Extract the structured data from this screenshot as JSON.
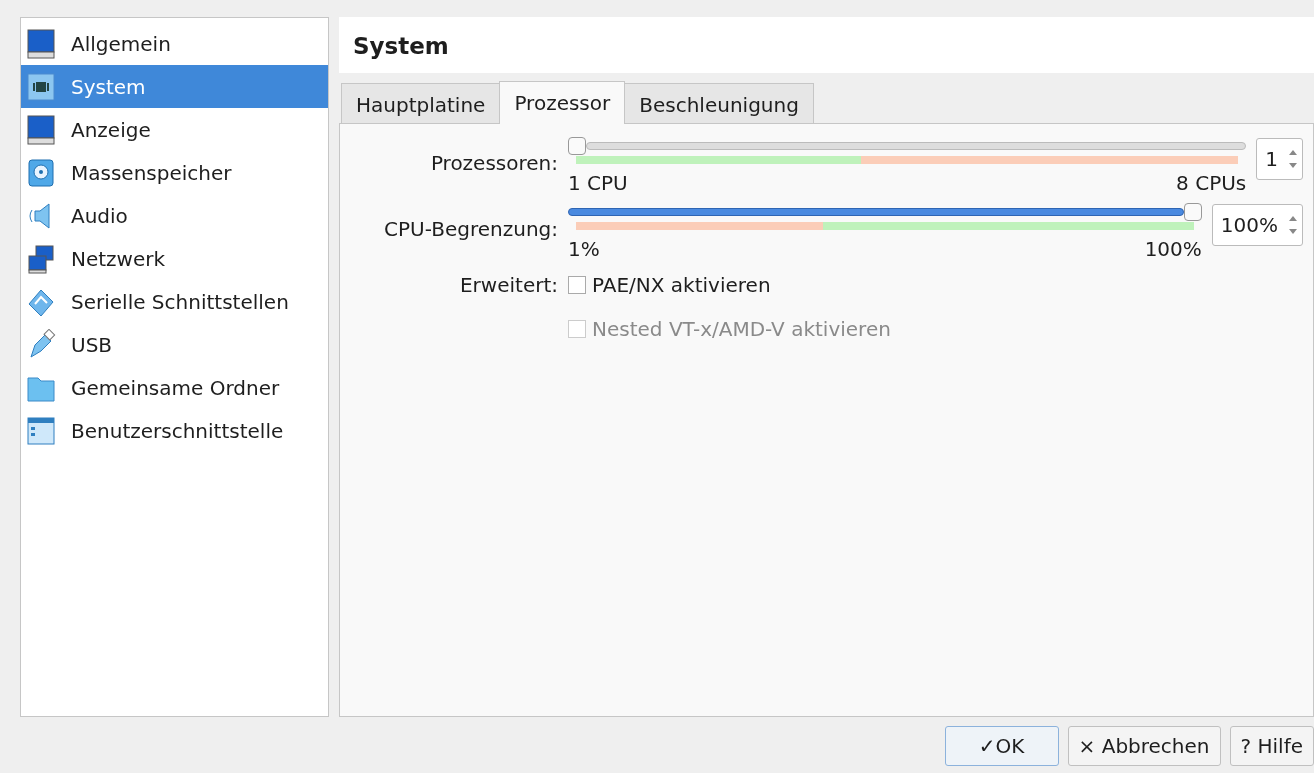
{
  "sidebar": {
    "items": [
      {
        "label": "Allgemein",
        "selected": false
      },
      {
        "label": "System",
        "selected": true
      },
      {
        "label": "Anzeige",
        "selected": false
      },
      {
        "label": "Massenspeicher",
        "selected": false
      },
      {
        "label": "Audio",
        "selected": false
      },
      {
        "label": "Netzwerk",
        "selected": false
      },
      {
        "label": "Serielle Schnittstellen",
        "selected": false
      },
      {
        "label": "USB",
        "selected": false
      },
      {
        "label": "Gemeinsame Ordner",
        "selected": false
      },
      {
        "label": "Benutzerschnittstelle",
        "selected": false
      }
    ]
  },
  "page_title": "System",
  "tabs": [
    {
      "label": "Hauptplatine",
      "selected": false
    },
    {
      "label": "Prozessor",
      "selected": true
    },
    {
      "label": "Beschleunigung",
      "selected": false
    }
  ],
  "sliders": [
    {
      "label": "Prozessoren:",
      "level": 0,
      "min_label": "1 CPU",
      "max_label": "8 CPUs",
      "value": "1",
      "band": {
        "level": 0.43,
        "zones": [
          {
            "color": "#bff2bb"
          },
          {
            "color": "#fbcdb8"
          }
        ]
      }
    },
    {
      "label": "CPU-Begrenzung:",
      "level": 1,
      "min_label": "1%",
      "max_label": "100%",
      "value": "100%",
      "band": {
        "level": 0.4,
        "zones": [
          {
            "color": "#fbcdb8"
          },
          {
            "color": "#bff2bb"
          }
        ]
      }
    }
  ],
  "extended": {
    "label": "Erweitert:",
    "options": [
      {
        "label": "PAE/NX aktivieren",
        "checked": false,
        "disabled": false
      },
      {
        "label": "Nested VT-x/AMD-V aktivieren",
        "checked": false,
        "disabled": true
      }
    ]
  },
  "buttons": [
    {
      "label": "✓OK",
      "default": true
    },
    {
      "label": "× Abbrechen",
      "default": false
    },
    {
      "label": "? Hilfe",
      "default": false
    }
  ]
}
